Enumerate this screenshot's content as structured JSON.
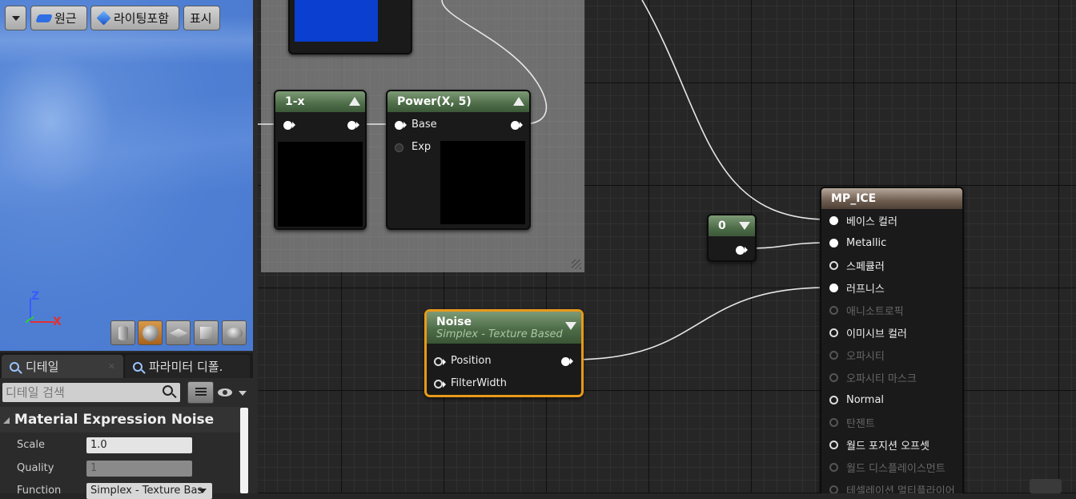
{
  "viewport_toolbar": {
    "dropdown_icon": "chevron-down-icon",
    "wireframe_label": "원근",
    "lighting_label": "라이팅포함",
    "show_label": "표시"
  },
  "axes": {
    "z": "Z",
    "x": "X"
  },
  "preview_buttons": [
    "cylinder-icon",
    "sphere-icon",
    "plane-icon",
    "cube-icon",
    "teapot-icon"
  ],
  "tabs": [
    {
      "label": "디테일",
      "icon": "search-icon"
    },
    {
      "label": "파라미터 디폴.",
      "icon": "search-icon"
    }
  ],
  "details": {
    "search_placeholder": "디테일 검색",
    "section_title": "Material Expression Noise",
    "props": [
      {
        "label": "Scale",
        "value": "1.0"
      },
      {
        "label": "Quality",
        "value": "1"
      },
      {
        "label": "Function",
        "value": "Simplex - Texture Bas"
      }
    ]
  },
  "graph": {
    "node_1minusx": {
      "title": "1-x"
    },
    "node_power": {
      "title": "Power(X, 5)",
      "inputs": [
        "Base",
        "Exp"
      ]
    },
    "node_const": {
      "title": "0"
    },
    "node_noise": {
      "title": "Noise",
      "subtitle": "Simplex - Texture Based",
      "inputs": [
        "Position",
        "FilterWidth"
      ]
    },
    "node_material": {
      "title": "MP_ICE",
      "inputs": [
        {
          "label": "베이스 컬러",
          "connected": true,
          "enabled": true
        },
        {
          "label": "Metallic",
          "connected": true,
          "enabled": true
        },
        {
          "label": "스페큘러",
          "connected": false,
          "enabled": true
        },
        {
          "label": "러프니스",
          "connected": true,
          "enabled": true
        },
        {
          "label": "애니소트로픽",
          "connected": false,
          "enabled": false
        },
        {
          "label": "이미시브 컬러",
          "connected": false,
          "enabled": true
        },
        {
          "label": "오파시티",
          "connected": false,
          "enabled": false
        },
        {
          "label": "오파시티 마스크",
          "connected": false,
          "enabled": false
        },
        {
          "label": "Normal",
          "connected": false,
          "enabled": true
        },
        {
          "label": "탄젠트",
          "connected": false,
          "enabled": false
        },
        {
          "label": "월드 포지션 오프셋",
          "connected": false,
          "enabled": true
        },
        {
          "label": "월드 디스플레이스먼트",
          "connected": false,
          "enabled": false
        },
        {
          "label": "테셀레이션 멀티플라이어",
          "connected": false,
          "enabled": false
        }
      ]
    }
  }
}
